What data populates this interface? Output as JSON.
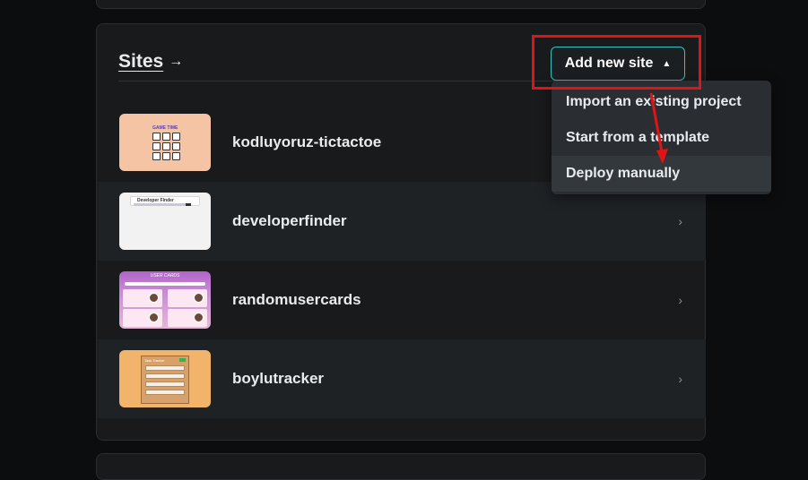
{
  "sites_section": {
    "title": "Sites",
    "title_arrow": "→",
    "add_button_label": "Add new site",
    "add_button_caret": "▲"
  },
  "sites": [
    {
      "name": "kodluyoruz-tictactoe",
      "thumb_text": "GAME TIME",
      "thumbnail_color": "#f5c4a5"
    },
    {
      "name": "developerfinder",
      "thumb_text": "Developer Finder",
      "thumbnail_color": "#f2f2f2"
    },
    {
      "name": "randomusercards",
      "thumb_text": "USER CARDS",
      "thumbnail_color": "#c88ad6"
    },
    {
      "name": "boylutracker",
      "thumb_text": "Task Tracker",
      "thumbnail_color": "#f2b36a"
    }
  ],
  "chevron": "›",
  "dropdown": {
    "items": [
      {
        "label": "Import an existing project"
      },
      {
        "label": "Start from a template"
      },
      {
        "label": "Deploy manually",
        "highlighted": true
      }
    ]
  },
  "colors": {
    "accent_border": "#35c4c0",
    "annotation_red": "#e01414",
    "card_bg": "#181a1c",
    "page_bg": "#0b0d0f"
  }
}
